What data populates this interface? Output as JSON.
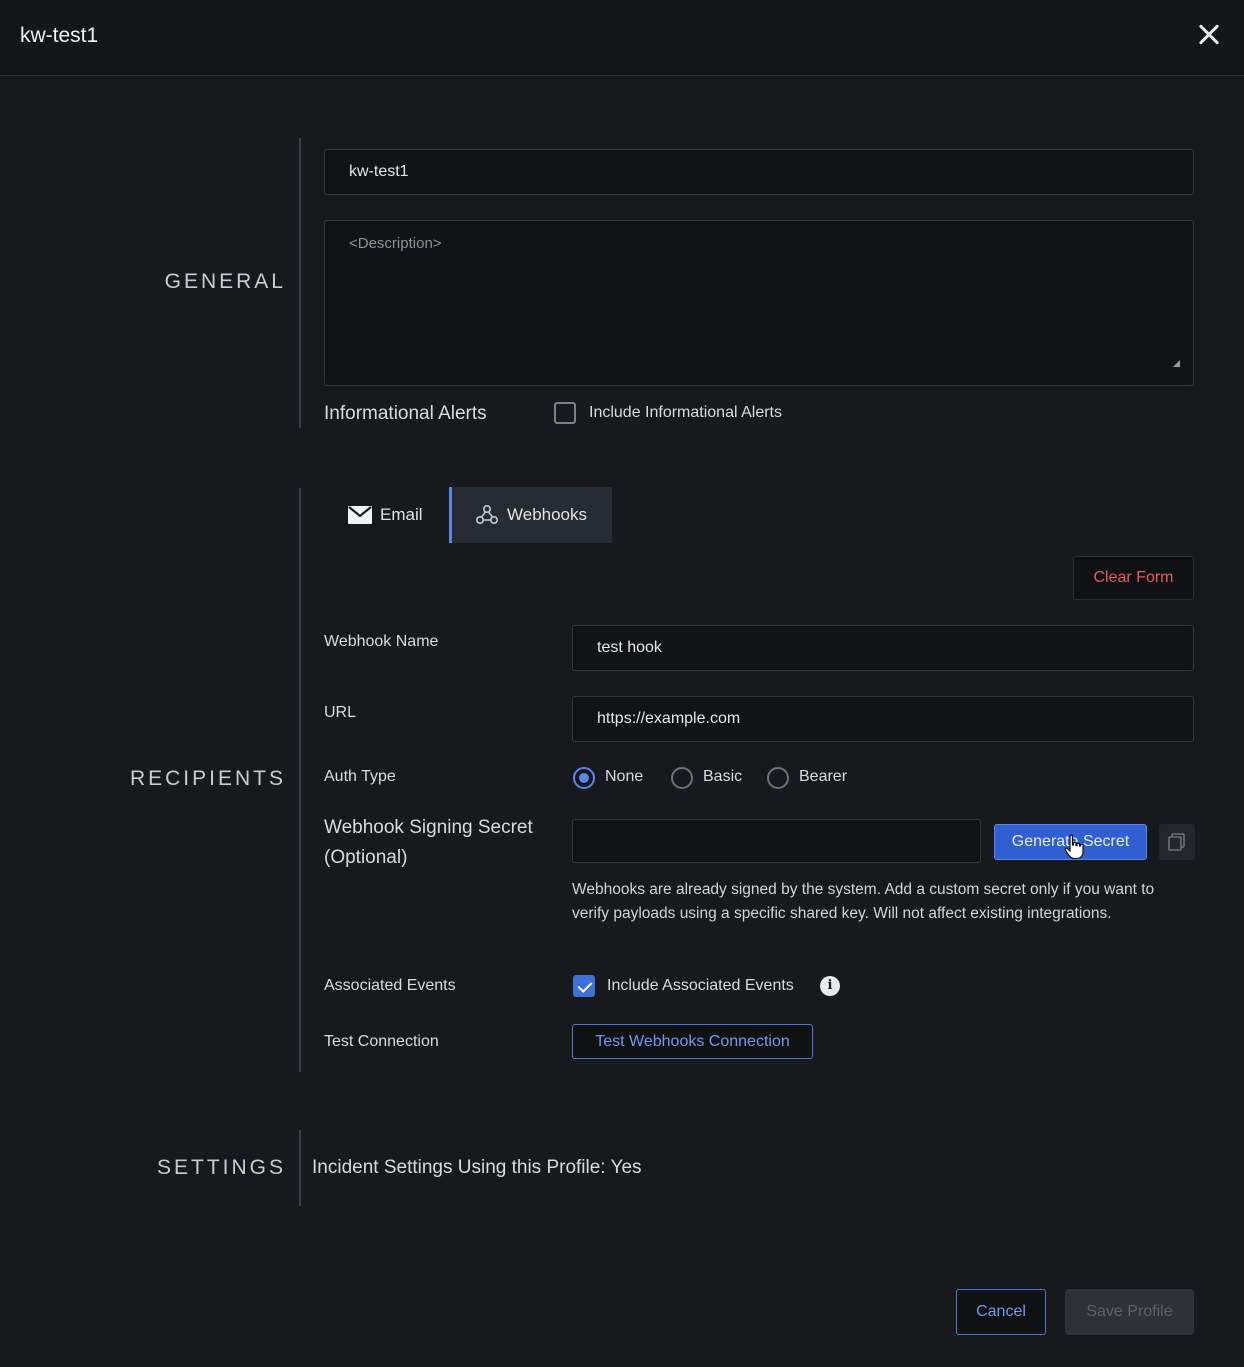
{
  "window": {
    "title": "kw-test1"
  },
  "sections": {
    "general": "GENERAL",
    "recipients": "RECIPIENTS",
    "settings": "SETTINGS"
  },
  "general": {
    "name_value": "kw-test1",
    "description_placeholder": "<Description>",
    "informational_alerts_label": "Informational Alerts",
    "include_informational_label": "Include Informational Alerts",
    "include_informational_checked": false
  },
  "tabs": [
    {
      "label": "Email",
      "icon": "envelope-icon",
      "active": false
    },
    {
      "label": "Webhooks",
      "icon": "webhook-icon",
      "active": true
    }
  ],
  "webhook": {
    "clear_form_label": "Clear Form",
    "name_label": "Webhook Name",
    "name_value": "test hook",
    "url_label": "URL",
    "url_value": "https://example.com",
    "auth_type_label": "Auth Type",
    "auth_options": [
      "None",
      "Basic",
      "Bearer"
    ],
    "auth_selected": "None",
    "secret_label_line1": "Webhook Signing Secret",
    "secret_label_line2": "(Optional)",
    "secret_value": "",
    "generate_secret_label": "Generate Secret",
    "secret_help": "Webhooks are already signed by the system. Add a custom secret only if you want to verify payloads using a specific shared key. Will not affect existing integrations.",
    "associated_events_label": "Associated Events",
    "include_associated_label": "Include Associated Events",
    "include_associated_checked": true,
    "test_connection_label": "Test Connection",
    "test_button_label": "Test Webhooks Connection"
  },
  "settings": {
    "incident_text": "Incident Settings Using this Profile: Yes"
  },
  "footer": {
    "cancel_label": "Cancel",
    "save_label": "Save Profile"
  },
  "colors": {
    "accent": "#5b86e5",
    "danger": "#e25b63",
    "background": "#17191c"
  }
}
